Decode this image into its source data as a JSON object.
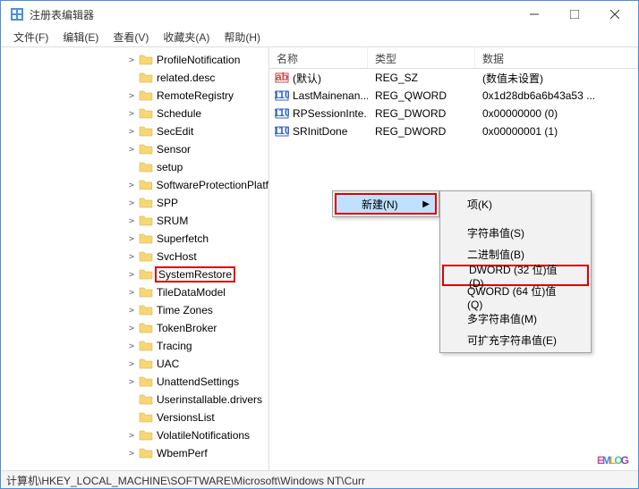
{
  "title": "注册表编辑器",
  "menu": {
    "file": "文件(F)",
    "edit": "编辑(E)",
    "view": "查看(V)",
    "fav": "收藏夹(A)",
    "help": "帮助(H)"
  },
  "tree": [
    {
      "label": "ProfileNotification",
      "exp": true
    },
    {
      "label": "related.desc",
      "exp": false
    },
    {
      "label": "RemoteRegistry",
      "exp": true
    },
    {
      "label": "Schedule",
      "exp": true
    },
    {
      "label": "SecEdit",
      "exp": true
    },
    {
      "label": "Sensor",
      "exp": true
    },
    {
      "label": "setup",
      "exp": false
    },
    {
      "label": "SoftwareProtectionPlatf",
      "exp": true
    },
    {
      "label": "SPP",
      "exp": true
    },
    {
      "label": "SRUM",
      "exp": true
    },
    {
      "label": "Superfetch",
      "exp": true
    },
    {
      "label": "SvcHost",
      "exp": true
    },
    {
      "label": "SystemRestore",
      "exp": true,
      "highlight": true
    },
    {
      "label": "TileDataModel",
      "exp": true
    },
    {
      "label": "Time Zones",
      "exp": true
    },
    {
      "label": "TokenBroker",
      "exp": true
    },
    {
      "label": "Tracing",
      "exp": true
    },
    {
      "label": "UAC",
      "exp": true
    },
    {
      "label": "UnattendSettings",
      "exp": true
    },
    {
      "label": "Userinstallable.drivers",
      "exp": false
    },
    {
      "label": "VersionsList",
      "exp": false
    },
    {
      "label": "VolatileNotifications",
      "exp": true
    },
    {
      "label": "WbemPerf",
      "exp": true
    }
  ],
  "cols": {
    "name": "名称",
    "type": "类型",
    "data": "数据"
  },
  "rows": [
    {
      "icon": "str",
      "name": "(默认)",
      "type": "REG_SZ",
      "data": "(数值未设置)"
    },
    {
      "icon": "bin",
      "name": "LastMainenan...",
      "type": "REG_QWORD",
      "data": "0x1d28db6a6b43a53 ..."
    },
    {
      "icon": "bin",
      "name": "RPSessionInte...",
      "type": "REG_DWORD",
      "data": "0x00000000 (0)"
    },
    {
      "icon": "bin",
      "name": "SRInitDone",
      "type": "REG_DWORD",
      "data": "0x00000001 (1)"
    }
  ],
  "ctx1": {
    "new": "新建(N)"
  },
  "ctx2": {
    "key": "项(K)",
    "str": "字符串值(S)",
    "bin": "二进制值(B)",
    "dword": "DWORD (32 位)值(D)",
    "qword": "QWORD (64 位)值(Q)",
    "multi": "多字符串值(M)",
    "expand": "可扩充字符串值(E)"
  },
  "status": "计算机\\HKEY_LOCAL_MACHINE\\SOFTWARE\\Microsoft\\Windows NT\\Curr",
  "watermark": "EMLOG"
}
